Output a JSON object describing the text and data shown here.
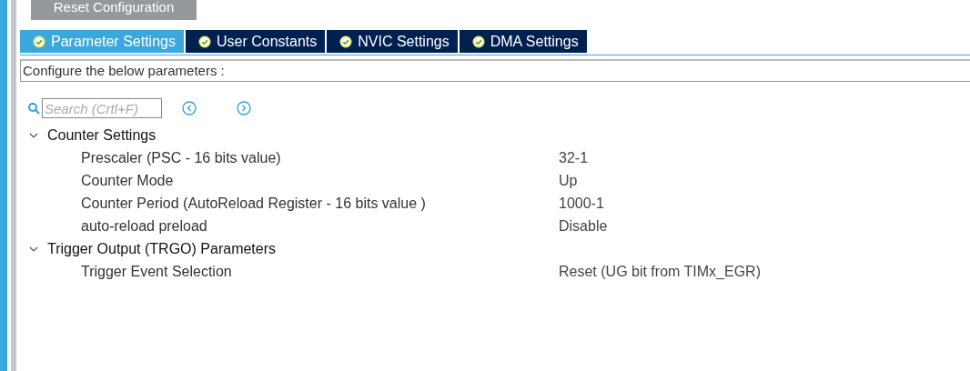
{
  "reset_button": {
    "label": "Reset Configuration"
  },
  "tabs": [
    {
      "label": "Parameter Settings",
      "selected": true
    },
    {
      "label": "User Constants",
      "selected": false
    },
    {
      "label": "NVIC Settings",
      "selected": false
    },
    {
      "label": "DMA Settings",
      "selected": false
    }
  ],
  "description": "Configure the below parameters :",
  "search": {
    "placeholder": "Search (Crtl+F)"
  },
  "groups": [
    {
      "label": "Counter Settings",
      "expanded": true,
      "children": [
        {
          "name": "Prescaler (PSC - 16 bits value)",
          "value": "32-1"
        },
        {
          "name": "Counter Mode",
          "value": "Up"
        },
        {
          "name": "Counter Period (AutoReload Register - 16 bits value )",
          "value": "1000-1"
        },
        {
          "name": "auto-reload preload",
          "value": "Disable"
        }
      ]
    },
    {
      "label": "Trigger Output (TRGO) Parameters",
      "expanded": true,
      "children": [
        {
          "name": "Trigger Event Selection",
          "value": "Reset (UG bit from TIMx_EGR)"
        }
      ]
    }
  ]
}
